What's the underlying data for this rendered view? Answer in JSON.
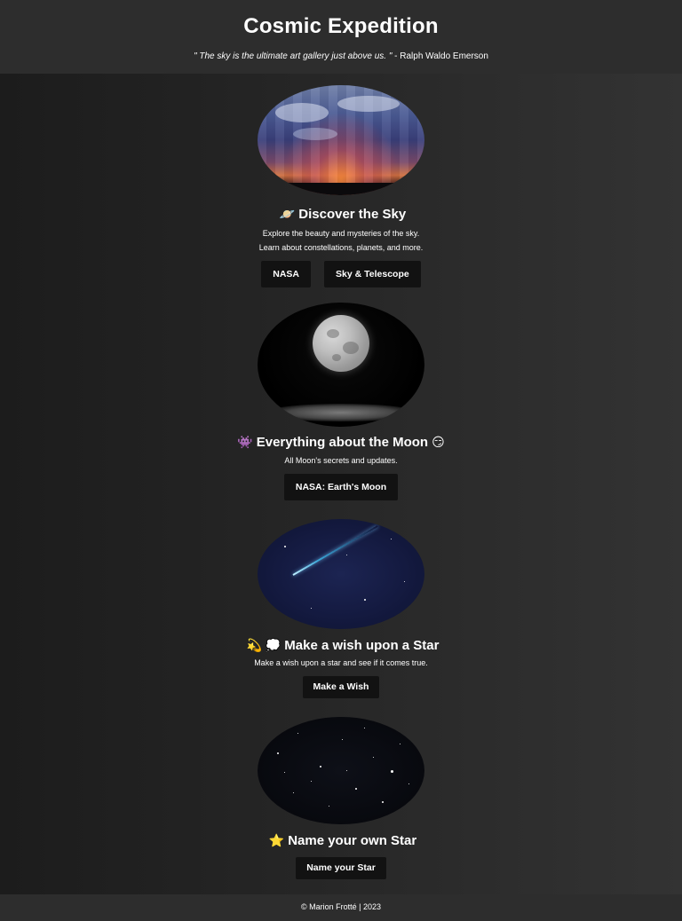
{
  "header": {
    "title": "Cosmic Expedition",
    "quote": "\" The sky is the ultimate art gallery just above us. \"",
    "quote_author": " - Ralph Waldo Emerson"
  },
  "sections": [
    {
      "emoji_left": "🪐",
      "title": "Discover the Sky",
      "emoji_right": "",
      "lines": [
        "Explore the beauty and mysteries of the sky.",
        "Learn about constellations, planets, and more."
      ],
      "buttons": [
        "NASA",
        "Sky & Telescope"
      ]
    },
    {
      "emoji_left": "👾",
      "title": "Everything about the Moon",
      "emoji_right": "😏",
      "lines": [
        "All Moon's secrets and updates."
      ],
      "buttons": [
        "NASA: Earth's Moon"
      ]
    },
    {
      "emoji_left": "💫 💭",
      "title": "Make a wish upon a Star",
      "emoji_right": "",
      "lines": [
        "Make a wish upon a star and see if it comes true."
      ],
      "buttons": [
        "Make a Wish"
      ]
    },
    {
      "emoji_left": "⭐",
      "title": "Name your own Star",
      "emoji_right": "",
      "lines": [],
      "buttons": [
        "Name your Star"
      ]
    }
  ],
  "footer": {
    "text": "© Marion Frotté | 2023"
  },
  "colors": {
    "header_bg": "#2d2d2d",
    "button_bg": "#121212",
    "text": "#ffffff"
  }
}
